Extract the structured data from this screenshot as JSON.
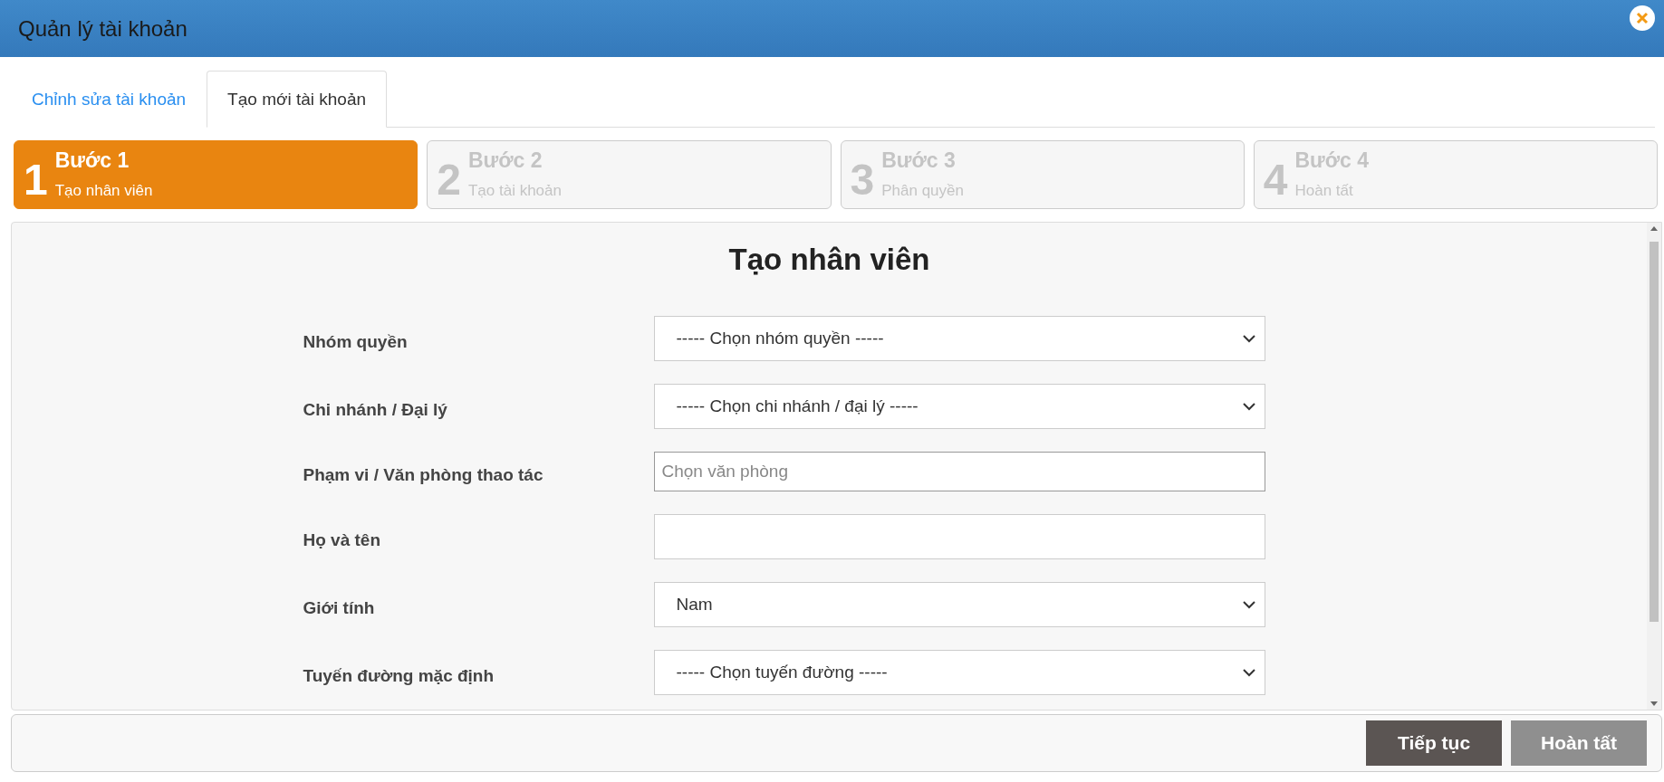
{
  "window": {
    "title": "Quản lý tài khoản"
  },
  "tabs": [
    {
      "label": "Chỉnh sửa tài khoản",
      "selected": false
    },
    {
      "label": "Tạo mới tài khoản",
      "selected": true
    }
  ],
  "steps": [
    {
      "number": "1",
      "title": "Bước 1",
      "subtitle": "Tạo nhân viên",
      "selected": true
    },
    {
      "number": "2",
      "title": "Bước 2",
      "subtitle": "Tạo tài khoản",
      "selected": false
    },
    {
      "number": "3",
      "title": "Bước 3",
      "subtitle": "Phân quyền",
      "selected": false
    },
    {
      "number": "4",
      "title": "Bước 4",
      "subtitle": "Hoàn tất",
      "selected": false
    }
  ],
  "form": {
    "title": "Tạo nhân viên",
    "fields": [
      {
        "label": "Nhóm quyền",
        "kind": "select",
        "value": "----- Chọn nhóm quyền -----"
      },
      {
        "label": "Chi nhánh / Đại lý",
        "kind": "select",
        "value": "----- Chọn chi nhánh / đại lý -----"
      },
      {
        "label": "Phạm vi / Văn phòng thao tác",
        "kind": "input",
        "placeholder": "Chọn văn phòng"
      },
      {
        "label": "Họ và tên",
        "kind": "input"
      },
      {
        "label": "Giới tính",
        "kind": "select",
        "value": "Nam"
      },
      {
        "label": "Tuyến đường mặc định",
        "kind": "select",
        "value": "----- Chọn tuyến đường -----"
      }
    ]
  },
  "buttons": [
    {
      "label": "Tiếp tục",
      "disabled": false
    },
    {
      "label": "Hoàn tất",
      "disabled": true
    }
  ]
}
